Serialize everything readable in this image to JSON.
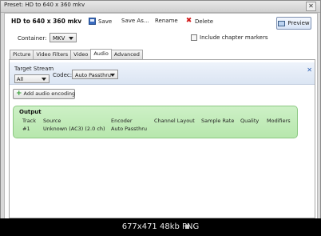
{
  "window": {
    "title": "Preset: HD to 640 x 360 mkv"
  },
  "toolbar": {
    "preset_name": "HD to 640 x 360 mkv",
    "save_label": "Save",
    "save_as_label": "Save As...",
    "rename_label": "Rename",
    "delete_label": "Delete",
    "preview_label": "Preview"
  },
  "container": {
    "label": "Container:",
    "value": "MKV"
  },
  "chapters": {
    "label": "Include chapter markers",
    "checked": false
  },
  "tabs": [
    {
      "label": "Picture"
    },
    {
      "label": "Video Filters"
    },
    {
      "label": "Video"
    },
    {
      "label": "Audio",
      "active": true
    },
    {
      "label": "Advanced"
    }
  ],
  "audio": {
    "target_stream_label": "Target Stream",
    "target_stream_value": "All",
    "codec_label": "Codec:",
    "codec_value": "Auto Passthru",
    "remove_icon": "close-icon",
    "add_label": "Add audio encoding"
  },
  "output": {
    "title": "Output",
    "headers": [
      "Track",
      "Source",
      "Encoder",
      "Channel Layout",
      "Sample Rate",
      "Quality",
      "Modifiers"
    ],
    "row": [
      "#1",
      "Unknown (AC3) (2.0 ch)",
      "Auto Passthru",
      "",
      "",
      "",
      ""
    ]
  },
  "status": {
    "text": "677x471 48kb PNG"
  },
  "colors": {
    "output_bg": "#c4edbb",
    "delete": "#d21a1a"
  }
}
